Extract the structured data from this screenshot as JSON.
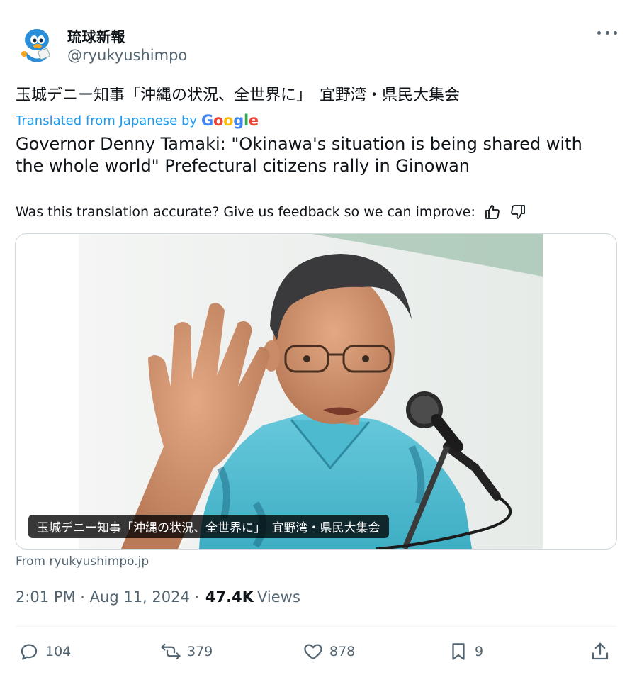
{
  "account": {
    "name": "琉球新報",
    "handle": "@ryukyushimpo"
  },
  "post": {
    "original_text": "玉城デニー知事「沖縄の状況、全世界に」　宜野湾・県民大集会",
    "translated_from": "Translated from Japanese by",
    "translator_brand": "Google",
    "translated_text": "Governor Denny Tamaki: \"Okinawa's situation is being shared with the whole world\" Prefectural citizens rally in Ginowan",
    "feedback_prompt": "Was this translation accurate? Give us feedback so we can improve:"
  },
  "link_card": {
    "caption": "玉城デニー知事「沖縄の状況、全世界に」　宜野湾・県民大集会",
    "source": "From ryukyushimpo.jp"
  },
  "meta": {
    "time": "2:01 PM",
    "date": "Aug 11, 2024",
    "views_count": "47.4K",
    "views_label": "Views"
  },
  "actions": {
    "replies": "104",
    "reposts": "379",
    "likes": "878",
    "bookmarks": "9"
  },
  "colors": {
    "accent": "#1d9bf0",
    "muted": "#536471",
    "shirt": "#5cc2d4"
  },
  "icons": [
    "avatar-mascot",
    "more-icon",
    "thumbs-up-icon",
    "thumbs-down-icon",
    "reply-icon",
    "repost-icon",
    "like-icon",
    "bookmark-icon",
    "share-icon"
  ]
}
